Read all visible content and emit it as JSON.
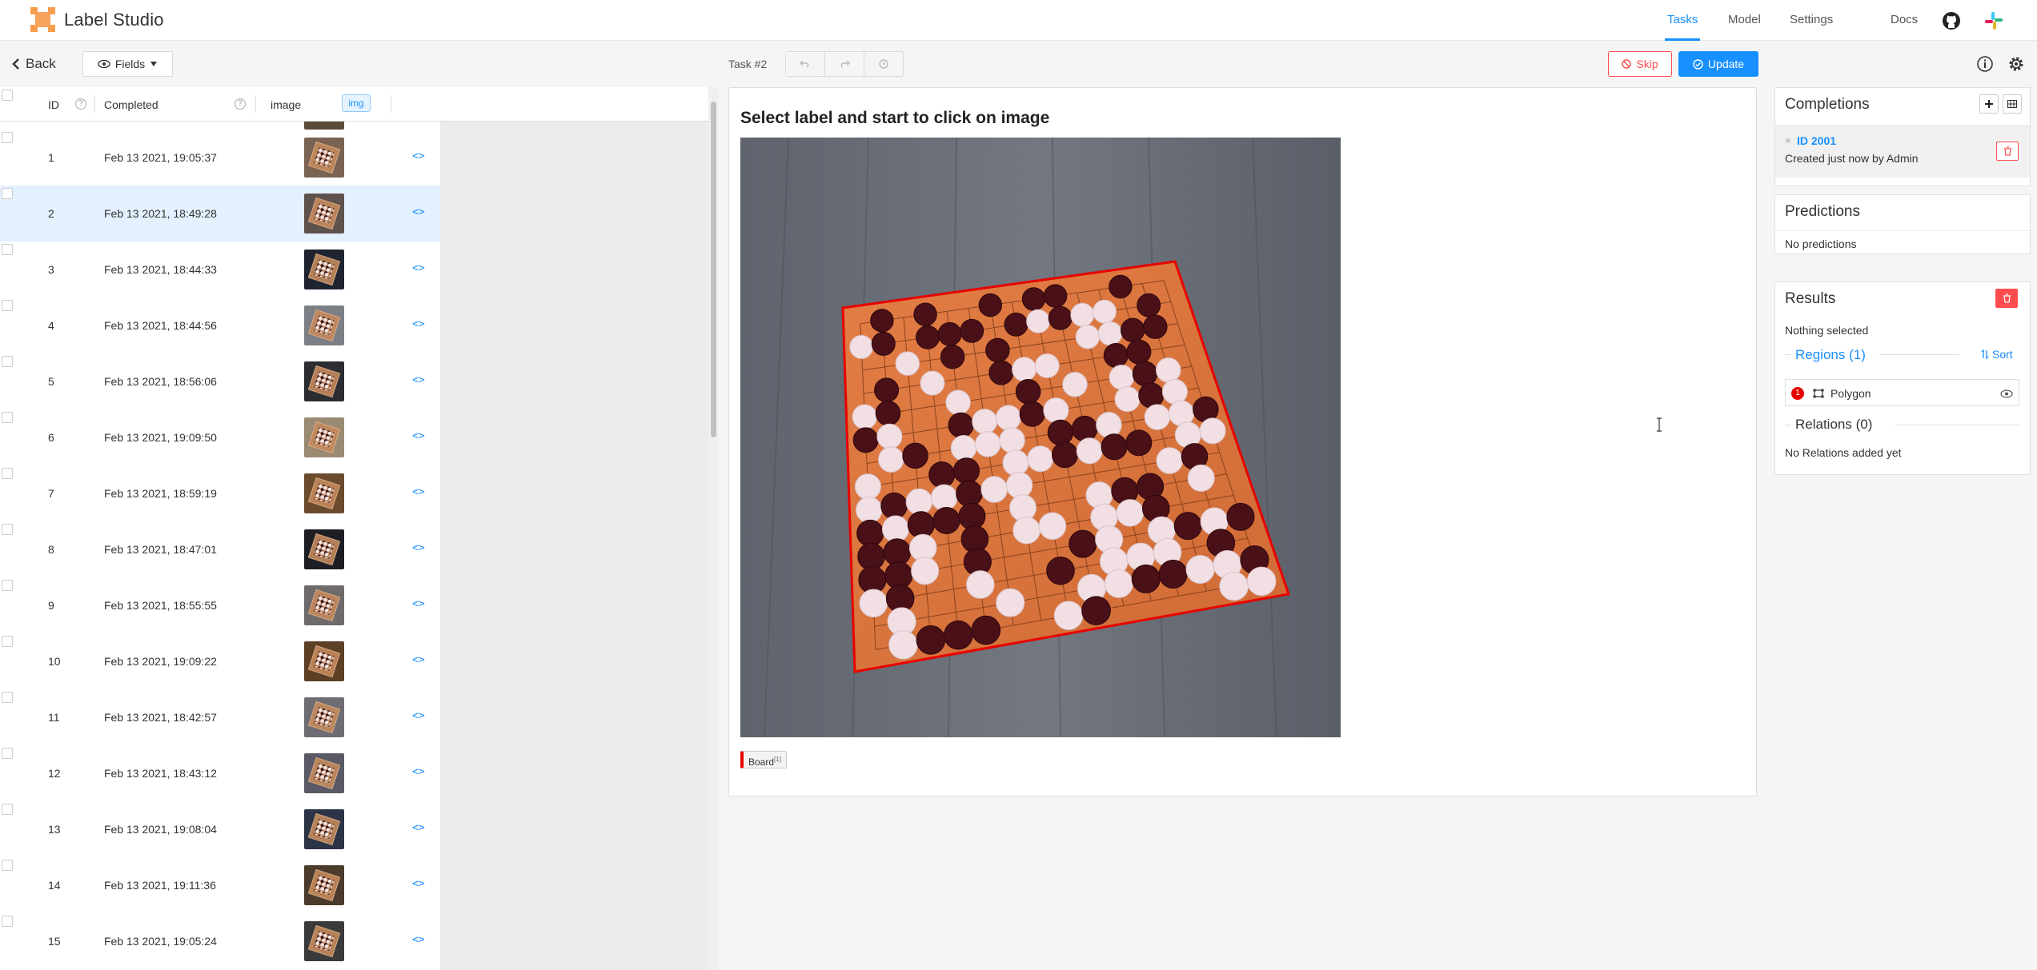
{
  "app": {
    "brand": "Label Studio",
    "nav": {
      "tasks": "Tasks",
      "model": "Model",
      "settings": "Settings",
      "docs": "Docs"
    }
  },
  "toolbar": {
    "back_label": "Back",
    "fields_label": "Fields",
    "task_label": "Task #2",
    "skip_label": "Skip",
    "update_label": "Update"
  },
  "table": {
    "columns": {
      "id": "ID",
      "completed": "Completed",
      "image": "image",
      "image_tag": "img"
    },
    "rows": [
      {
        "id": "1",
        "completed": "Feb 13 2021, 19:05:37",
        "code": "<>"
      },
      {
        "id": "2",
        "completed": "Feb 13 2021, 18:49:28",
        "code": "<>",
        "selected": true
      },
      {
        "id": "3",
        "completed": "Feb 13 2021, 18:44:33",
        "code": "<>"
      },
      {
        "id": "4",
        "completed": "Feb 13 2021, 18:44:56",
        "code": "<>"
      },
      {
        "id": "5",
        "completed": "Feb 13 2021, 18:56:06",
        "code": "<>"
      },
      {
        "id": "6",
        "completed": "Feb 13 2021, 19:09:50",
        "code": "<>"
      },
      {
        "id": "7",
        "completed": "Feb 13 2021, 18:59:19",
        "code": "<>"
      },
      {
        "id": "8",
        "completed": "Feb 13 2021, 18:47:01",
        "code": "<>"
      },
      {
        "id": "9",
        "completed": "Feb 13 2021, 18:55:55",
        "code": "<>"
      },
      {
        "id": "10",
        "completed": "Feb 13 2021, 19:09:22",
        "code": "<>"
      },
      {
        "id": "11",
        "completed": "Feb 13 2021, 18:42:57",
        "code": "<>"
      },
      {
        "id": "12",
        "completed": "Feb 13 2021, 18:43:12",
        "code": "<>"
      },
      {
        "id": "13",
        "completed": "Feb 13 2021, 19:08:04",
        "code": "<>"
      },
      {
        "id": "14",
        "completed": "Feb 13 2021, 19:11:36",
        "code": "<>"
      },
      {
        "id": "15",
        "completed": "Feb 13 2021, 19:05:24",
        "code": "<>"
      }
    ]
  },
  "editor": {
    "title": "Select label and start to click on image",
    "label_chip": "Board",
    "label_hotkey": "[1]"
  },
  "side": {
    "completions_title": "Completions",
    "completion_id": "ID 2001",
    "completion_sub": "Created just now by Admin",
    "predictions_title": "Predictions",
    "predictions_empty": "No predictions",
    "results_title": "Results",
    "nothing_selected": "Nothing selected",
    "regions_label": "Regions (1)",
    "sort_label": "Sort",
    "region_number": "1",
    "region_type": "Polygon",
    "relations_label": "Relations (0)",
    "relations_empty": "No Relations added yet"
  },
  "colors": {
    "accent": "#1890ff",
    "danger": "#ff4d4f",
    "region": "#e80000",
    "board": "#d9743b"
  },
  "icons": [
    "chevron-left-icon",
    "eye-icon",
    "caret-down-icon",
    "undo-icon",
    "redo-icon",
    "reset-icon",
    "stop-icon",
    "check-circle-icon",
    "info-icon",
    "gear-icon",
    "github-icon",
    "slack-icon",
    "plus-icon",
    "columns-icon",
    "trash-icon",
    "sort-icon",
    "polygon-icon",
    "help-icon",
    "code-icon"
  ]
}
